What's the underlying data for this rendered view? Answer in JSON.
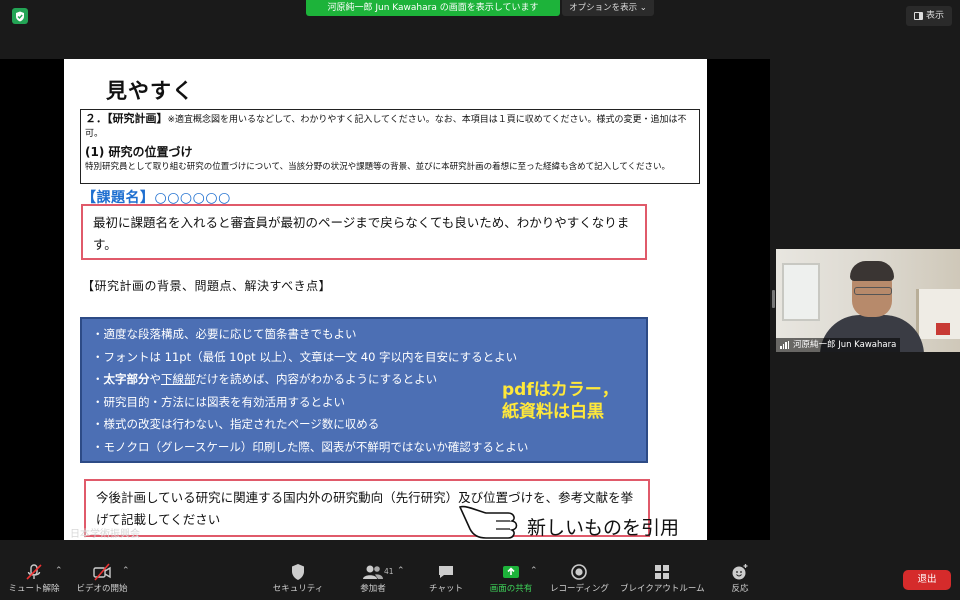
{
  "top": {
    "share_banner": "河原純一郎 Jun Kawahara の画面を表示しています",
    "options_label": "オプションを表示 ⌄",
    "view_label": "表示"
  },
  "document": {
    "title": "見やすく",
    "plan_heading": "２．【研究計画】",
    "plan_note": "※適宜概念図を用いるなどして、わかりやすく記入してください。なお、本項目は１頁に収めてください。様式の変更・追加は不可。",
    "position_heading": "(1) 研究の位置づけ",
    "position_desc": "特別研究員として取り組む研究の位置づけについて、当該分野の状況や課題等の背景、並びに本研究計画の着想に至った経緯も含めて記入してください。",
    "topic_label": "【課題名】○○○○○○",
    "red_box_1": "最初に課題名を入れると審査員が最初のページまで戻らなくても良いため、わかりやすくなります。",
    "background_heading": "【研究計画の背景、問題点、解決すべき点】",
    "bullets": [
      "・適度な段落構成、必要に応じて箇条書きでもよい",
      "・フォントは 11pt（最低 10pt 以上）、文章は一文 40 字以内を目安にするとよい",
      "・研究目的・方法には図表を有効活用するとよい",
      "・様式の改変は行わない、指定されたページ数に収める",
      "・モノクロ（グレースケール）印刷した際、図表が不鮮明ではないか確認するとよい"
    ],
    "bullet_bold_prefix": "・",
    "bullet_bold_part": "太字部分",
    "bullet_mid": "や",
    "bullet_underline_part": "下線部",
    "bullet_tail": "だけを読めば、内容がわかるようにするとよい",
    "callout_line1": "pdfはカラー，",
    "callout_line2": "紙資料は白黒",
    "red_box_2": "今後計画している研究に関連する国内外の研究動向（先行研究）及び位置づけを、参考文献を挙げて記載してください",
    "new_cite": "新しいものを引用",
    "watermark": "日本学術振興会"
  },
  "video": {
    "name": "河原純一郎 Jun Kawahara"
  },
  "toolbar": {
    "mute_label": "ミュート解除",
    "video_label": "ビデオの開始",
    "security_label": "セキュリティ",
    "participants_label": "参加者",
    "participants_count": "41",
    "chat_label": "チャット",
    "share_label": "画面の共有",
    "record_label": "レコーディング",
    "breakout_label": "ブレイクアウトルーム",
    "reactions_label": "反応",
    "leave_label": "退出"
  },
  "colors": {
    "share_green": "#1db33a",
    "leave_red": "#d52b2b",
    "blue_box": "#4c6fb4",
    "callout_yellow": "#ffe83a",
    "red_border": "#e05a6a",
    "topic_blue": "#1e6fd0"
  }
}
